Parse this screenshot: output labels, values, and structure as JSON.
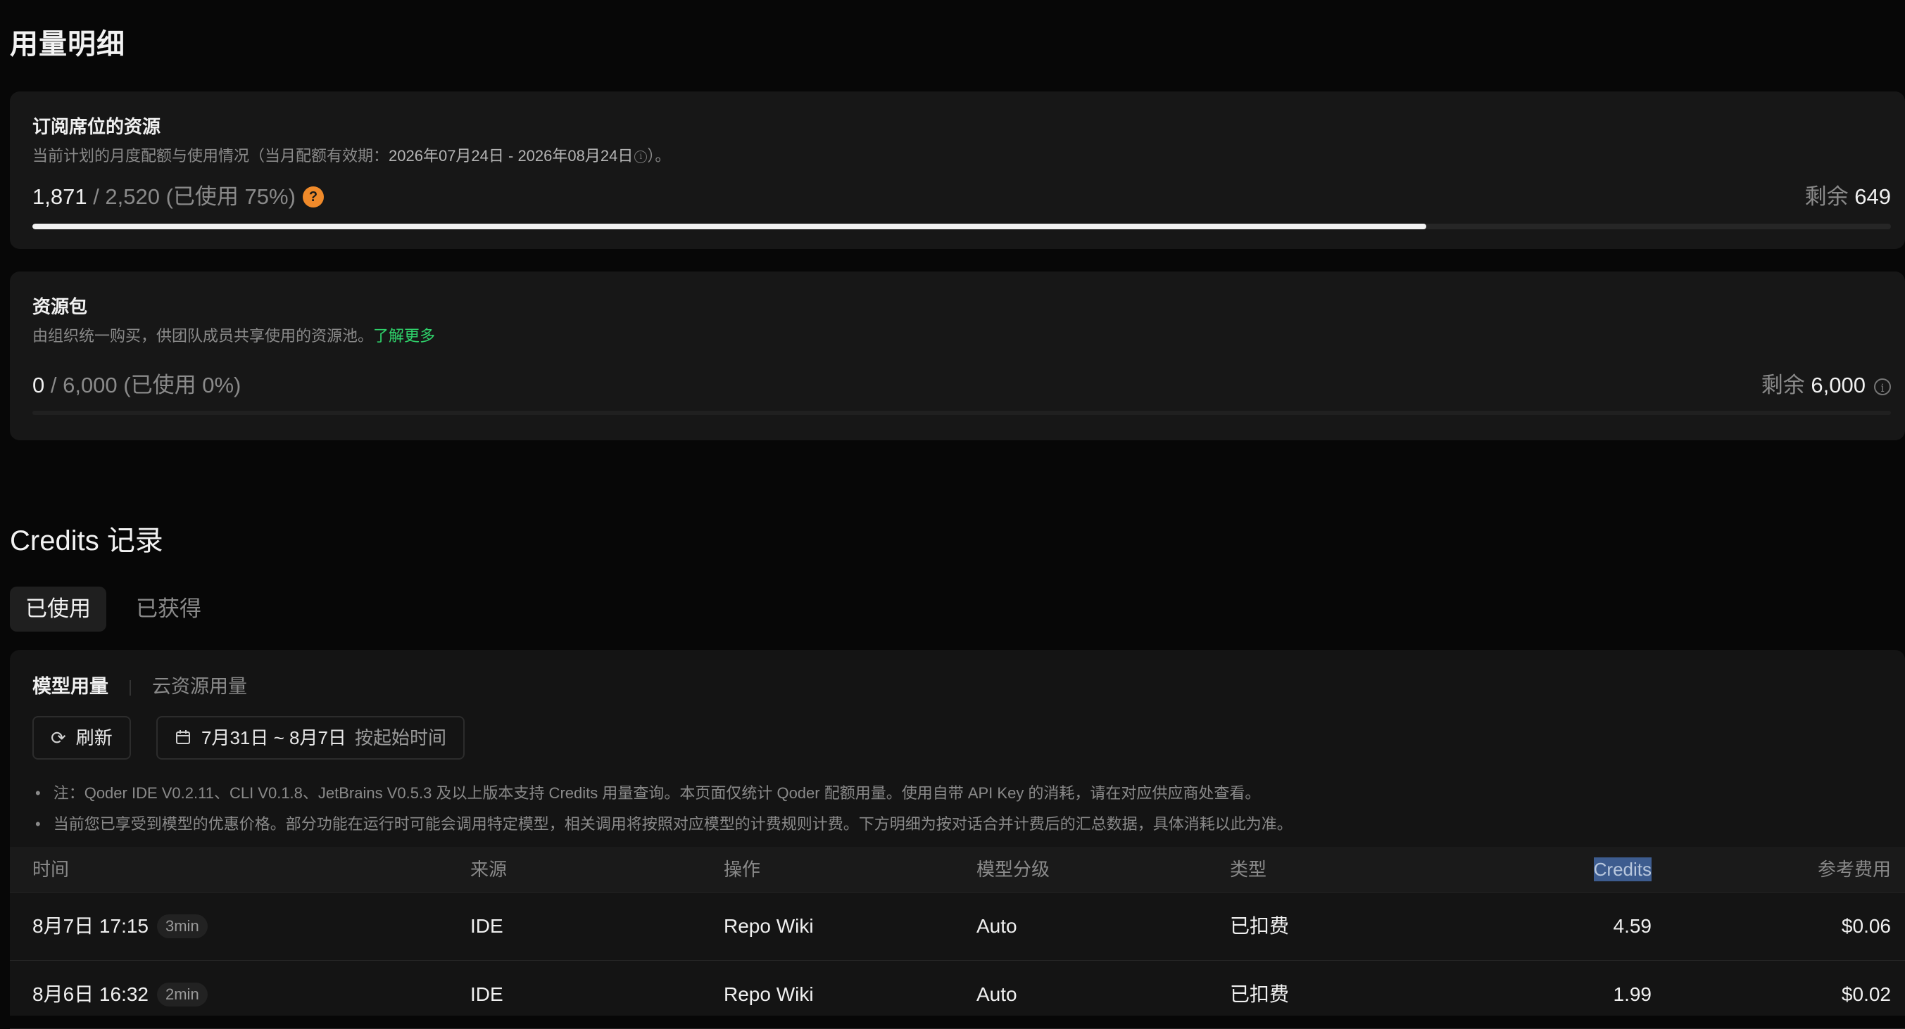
{
  "page": {
    "title": "用量明细"
  },
  "subscription": {
    "title": "订阅席位的资源",
    "desc_prefix": "当前计划的月度配额与使用情况（当月配额有效期：",
    "desc_period": "2026年07月24日 - 2026年08月24日",
    "desc_suffix": "）。",
    "used": "1,871",
    "total_text": " / 2,520 (已使用 75%)",
    "help_glyph": "?",
    "remain_label": "剩余 ",
    "remain_value": "649",
    "progress": 0.75
  },
  "pack": {
    "title": "资源包",
    "desc": "由组织统一购买，供团队成员共享使用的资源池。",
    "learn_more": "了解更多",
    "used": "0",
    "total_text": " / 6,000 (已使用 0%)",
    "remain_label": "剩余 ",
    "remain_value": "6,000",
    "progress": 0
  },
  "credits": {
    "title": "Credits 记录",
    "tabs": [
      {
        "label": "已使用"
      },
      {
        "label": "已获得"
      }
    ],
    "subtabs": [
      {
        "label": "模型用量"
      },
      {
        "label": "云资源用量"
      }
    ],
    "refresh_label": "刷新",
    "date_range": "7月31日 ~ 8月7日",
    "sort_label": "按起始时间",
    "notes": [
      "注：Qoder IDE V0.2.11、CLI V0.1.8、JetBrains V0.5.3 及以上版本支持 Credits 用量查询。本页面仅统计 Qoder 配额用量。使用自带 API Key 的消耗，请在对应供应商处查看。",
      "当前您已享受到模型的优惠价格。部分功能在运行时可能会调用特定模型，相关调用将按照对应模型的计费规则计费。下方明细为按对话合并计费后的汇总数据，具体消耗以此为准。"
    ],
    "columns": {
      "time": "时间",
      "source": "来源",
      "operation": "操作",
      "tier": "模型分级",
      "type": "类型",
      "credits": "Credits",
      "cost": "参考费用"
    },
    "rows": [
      {
        "time": "8月7日 17:15",
        "duration": "3min",
        "source": "IDE",
        "operation": "Repo Wiki",
        "tier": "Auto",
        "type": "已扣费",
        "credits": "4.59",
        "cost": "$0.06"
      },
      {
        "time": "8月6日 16:32",
        "duration": "2min",
        "source": "IDE",
        "operation": "Repo Wiki",
        "tier": "Auto",
        "type": "已扣费",
        "credits": "1.99",
        "cost": "$0.02"
      }
    ]
  },
  "colors": {
    "accent_link": "#2fd36b",
    "help_badge": "#f08a2a",
    "selection": "#3d5c8f"
  },
  "icons": {
    "refresh": "refresh-icon",
    "calendar": "calendar-icon",
    "help": "help-icon",
    "info": "info-icon"
  }
}
